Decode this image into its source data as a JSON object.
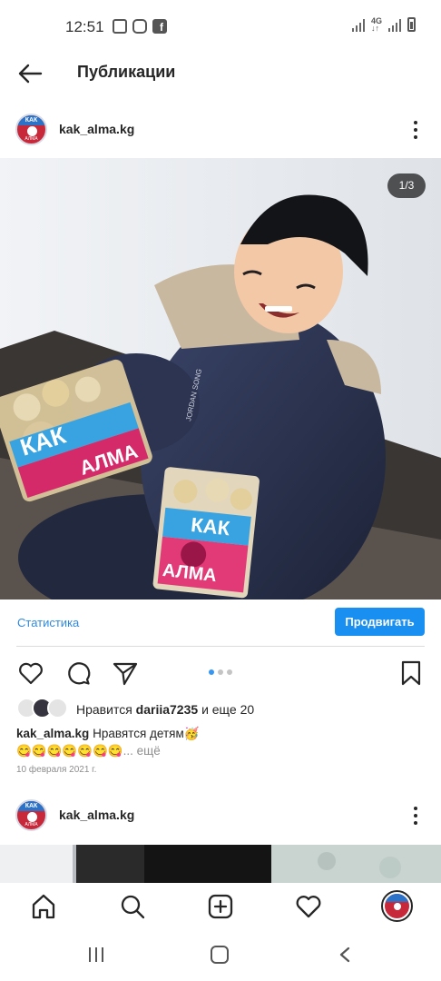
{
  "status_bar": {
    "time": "12:51",
    "left_icons": [
      "gallery-icon",
      "instagram-icon",
      "facebook-icon"
    ],
    "right_icons": [
      "signal-icon",
      "4g-icon",
      "signal-icon",
      "battery-icon"
    ],
    "network_label": "4G"
  },
  "header": {
    "title": "Публикации",
    "back_icon": "arrow-left-icon"
  },
  "post": {
    "username": "kak_alma.kg",
    "image_counter": "1/3",
    "stats_link": "Статистика",
    "promote_button": "Продвигать",
    "likes_prefix": "Нравится",
    "likes_user": "dariia7235",
    "likes_suffix": "и еще 20",
    "caption_user": "kak_alma.kg",
    "caption_text": "Нравятся детям🥳",
    "caption_line2": "😋😋😋😋😋😋😋",
    "caption_more": "... ещё",
    "date": "10 февраля 2021 г.",
    "carousel": {
      "count": 3,
      "active_index": 0
    },
    "packages": [
      {
        "top": "КАК",
        "bottom": "АЛМА"
      },
      {
        "top": "КАК",
        "bottom": "АЛМА"
      }
    ],
    "jacket_text": "JORDAN SONG"
  },
  "next_post": {
    "username": "kak_alma.kg"
  },
  "avatar_logo": {
    "top": "КАК",
    "bottom": "АЛМА"
  },
  "colors": {
    "accent_blue": "#1a8ff2",
    "link_blue": "#2f8adf",
    "brand_red": "#c7283a",
    "brand_blue": "#2c73c7"
  },
  "bottom_nav": [
    "home-icon",
    "search-icon",
    "add-post-icon",
    "activity-heart-icon",
    "profile-avatar"
  ],
  "system_nav": [
    "recent-apps-icon",
    "home-button-icon",
    "back-button-icon"
  ]
}
